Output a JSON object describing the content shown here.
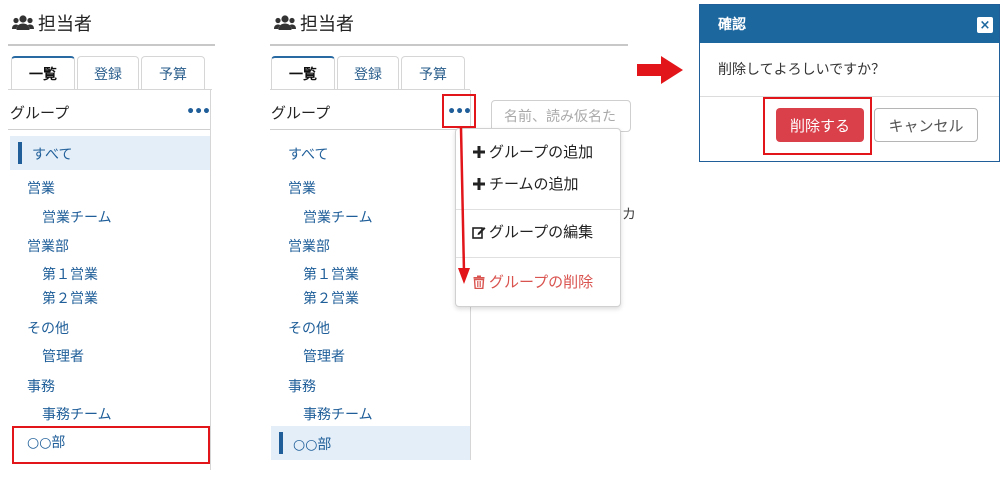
{
  "panel_a": {
    "header_title": "担当者",
    "tabs": [
      {
        "label": "一覧"
      },
      {
        "label": "登録"
      },
      {
        "label": "予算"
      }
    ],
    "group_label": "グループ",
    "more_glyph": "•••",
    "tree": [
      {
        "label": "すべて",
        "selected": true
      },
      {
        "label": "営業"
      },
      {
        "label": "営業チーム"
      },
      {
        "label": "営業部"
      },
      {
        "label": "第１営業"
      },
      {
        "label": "第２営業"
      },
      {
        "label": "その他"
      },
      {
        "label": "管理者"
      },
      {
        "label": "事務"
      },
      {
        "label": "事務チーム"
      },
      {
        "label": "○○部"
      }
    ]
  },
  "panel_b": {
    "header_title": "担当者",
    "tabs": [
      {
        "label": "一覧"
      },
      {
        "label": "登録"
      },
      {
        "label": "予算"
      }
    ],
    "group_label": "グループ",
    "more_glyph": "•••",
    "search_placeholder": "名前、読み仮名た",
    "partial_char": "カ",
    "tree": [
      {
        "label": "すべて"
      },
      {
        "label": "営業"
      },
      {
        "label": "営業チーム"
      },
      {
        "label": "営業部"
      },
      {
        "label": "第１営業"
      },
      {
        "label": "第２営業"
      },
      {
        "label": "その他"
      },
      {
        "label": "管理者"
      },
      {
        "label": "事務"
      },
      {
        "label": "事務チーム"
      },
      {
        "label": "○○部",
        "selected": true
      }
    ],
    "menu": {
      "add_group": "グループの追加",
      "add_team": "チームの追加",
      "edit_group": "グループの編集",
      "delete_group": "グループの削除"
    }
  },
  "dialog": {
    "title": "確認",
    "close_glyph": "×",
    "message": "削除してよろしいですか？",
    "delete_label": "削除する",
    "cancel_label": "キャンセル"
  },
  "colors": {
    "accent": "#1d679f",
    "link": "#1f5e99",
    "danger": "#d9404a",
    "highlight": "#e1151a"
  },
  "icons": {
    "header": "users-icon",
    "more": "ellipsis-icon",
    "add": "plus-icon",
    "edit": "edit-icon",
    "delete": "trash-icon",
    "close": "close-icon",
    "flow": "arrow-right-icon"
  }
}
